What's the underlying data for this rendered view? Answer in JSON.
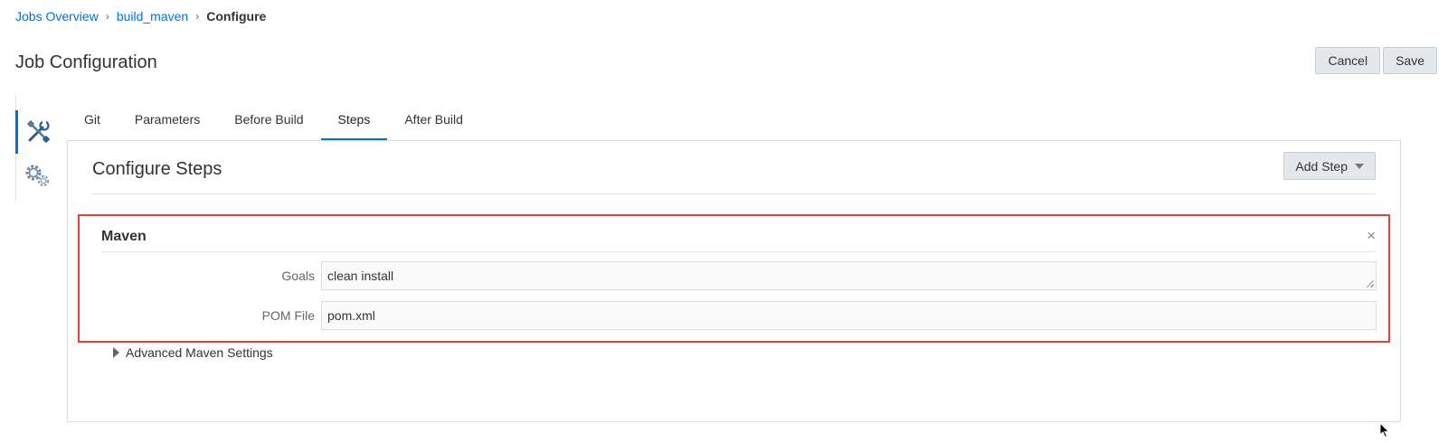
{
  "breadcrumb": {
    "items": [
      "Jobs Overview",
      "build_maven"
    ],
    "current": "Configure",
    "separator": "›"
  },
  "page": {
    "title": "Job Configuration"
  },
  "header_actions": {
    "cancel_label": "Cancel",
    "save_label": "Save"
  },
  "side_tabs": [
    {
      "icon": "tools-icon",
      "active": true
    },
    {
      "icon": "gears-icon",
      "active": false
    }
  ],
  "tabs": [
    {
      "label": "Git",
      "active": false
    },
    {
      "label": "Parameters",
      "active": false
    },
    {
      "label": "Before Build",
      "active": false
    },
    {
      "label": "Steps",
      "active": true
    },
    {
      "label": "After Build",
      "active": false
    }
  ],
  "panel": {
    "title": "Configure Steps",
    "add_step_label": "Add Step"
  },
  "step": {
    "title": "Maven",
    "close_glyph": "×",
    "fields": [
      {
        "label": "Goals",
        "value": "clean install"
      },
      {
        "label": "POM File",
        "value": "pom.xml"
      }
    ]
  },
  "advanced": {
    "label": "Advanced Maven Settings"
  },
  "colors": {
    "accent": "#0572ce",
    "highlight": "#e0413a"
  }
}
